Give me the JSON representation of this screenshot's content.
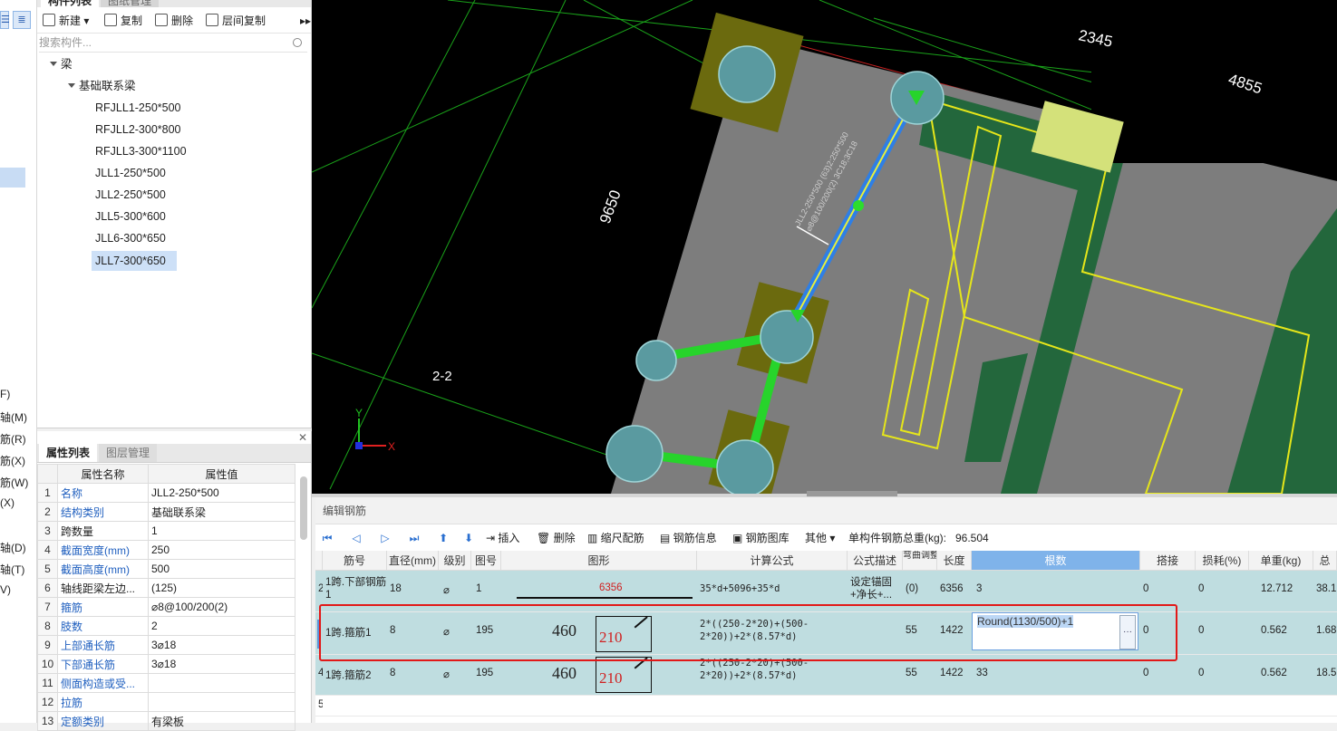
{
  "left_strip": {
    "labels": [
      "F)",
      "轴(M)",
      "筋(R)",
      "筋(X)",
      "筋(W)",
      "(X)",
      "轴(D)",
      "轴(T)",
      "V)"
    ]
  },
  "component_panel": {
    "tabs": [
      "构件列表",
      "图纸管理"
    ],
    "toolbar": {
      "new": "新建",
      "copy": "复制",
      "delete": "删除",
      "floor_copy": "层间复制"
    },
    "search_placeholder": "搜索构件...",
    "tree": {
      "root": "梁",
      "group": "基础联系梁",
      "items": [
        "RFJLL1-250*500",
        "RFJLL2-300*800",
        "RFJLL3-300*1100",
        "JLL1-250*500",
        "JLL2-250*500",
        "JLL5-300*600",
        "JLL6-300*650",
        "JLL7-300*650"
      ],
      "selected_index": 7
    }
  },
  "property_panel": {
    "tabs": [
      "属性列表",
      "图层管理"
    ],
    "headers": [
      "属性名称",
      "属性值"
    ],
    "rows": [
      {
        "n": "1",
        "name": "名称",
        "value": "JLL2-250*500",
        "blue": true
      },
      {
        "n": "2",
        "name": "结构类别",
        "value": "基础联系梁",
        "blue": true
      },
      {
        "n": "3",
        "name": "跨数量",
        "value": "1",
        "blue": false
      },
      {
        "n": "4",
        "name": "截面宽度(mm)",
        "value": "250",
        "blue": true
      },
      {
        "n": "5",
        "name": "截面高度(mm)",
        "value": "500",
        "blue": true
      },
      {
        "n": "6",
        "name": "轴线距梁左边...",
        "value": "(125)",
        "blue": false
      },
      {
        "n": "7",
        "name": "箍筋",
        "value": "⌀8@100/200(2)",
        "blue": true
      },
      {
        "n": "8",
        "name": "肢数",
        "value": "2",
        "blue": true
      },
      {
        "n": "9",
        "name": "上部通长筋",
        "value": "3⌀18",
        "blue": true
      },
      {
        "n": "10",
        "name": "下部通长筋",
        "value": "3⌀18",
        "blue": true
      },
      {
        "n": "11",
        "name": "侧面构造或受...",
        "value": "",
        "blue": true
      },
      {
        "n": "12",
        "name": "拉筋",
        "value": "",
        "blue": true
      },
      {
        "n": "13",
        "name": "定额类别",
        "value": "有梁板",
        "blue": true
      }
    ]
  },
  "cad": {
    "dims": [
      "2345",
      "4855",
      "9650"
    ],
    "axis_label": "2-2",
    "beam_annotation_1": "JLL2-250*500 (63)2:250*500",
    "beam_annotation_2": "⌀8@100/200(2) 3C18;3C18",
    "axis_x": "X",
    "axis_y": "Y"
  },
  "rebar_editor": {
    "title": "编辑钢筋",
    "toolbar": {
      "insert": "插入",
      "delete": "删除",
      "scale": "缩尺配筋",
      "info": "钢筋信息",
      "library": "钢筋图库",
      "other": "其他",
      "total_label": "单构件钢筋总重(kg):",
      "total_value": "96.504"
    },
    "headers": [
      "筋号",
      "直径(mm)",
      "级别",
      "图号",
      "图形",
      "计算公式",
      "公式描述",
      "弯曲调整",
      "长度",
      "根数",
      "搭接",
      "损耗(%)",
      "单重(kg)",
      "总"
    ],
    "rows": [
      {
        "idx": "2",
        "name": "1跨.下部钢筋1",
        "dia": "18",
        "grade": "⌀",
        "fig": "1",
        "shape_len": "6356",
        "formula": "35*d+5096+35*d",
        "desc": "设定锚固+净长+...",
        "bend": "(0)",
        "length": "6356",
        "count": "3",
        "lap": "0",
        "loss": "0",
        "unit": "12.712",
        "total": "38.1"
      },
      {
        "idx": "3",
        "name": "1跨.箍筋1",
        "dia": "8",
        "grade": "⌀",
        "fig": "195",
        "shape_a": "460",
        "shape_b": "210",
        "formula": "2*((250-2*20)+(500-2*20))+2*(8.57*d)",
        "desc": "",
        "bend": "55",
        "length": "1422",
        "count": "Round(1130/500)+1",
        "lap": "0",
        "loss": "0",
        "unit": "0.562",
        "total": "1.68"
      },
      {
        "idx": "4",
        "name": "1跨.箍筋2",
        "dia": "8",
        "grade": "⌀",
        "fig": "195",
        "shape_a": "460",
        "shape_b": "210",
        "formula": "2*((250-2*20)+(500-2*20))+2*(8.57*d)",
        "desc": "",
        "bend": "55",
        "length": "1422",
        "count": "33",
        "lap": "0",
        "loss": "0",
        "unit": "0.562",
        "total": "18.5"
      },
      {
        "idx": "5"
      }
    ]
  }
}
